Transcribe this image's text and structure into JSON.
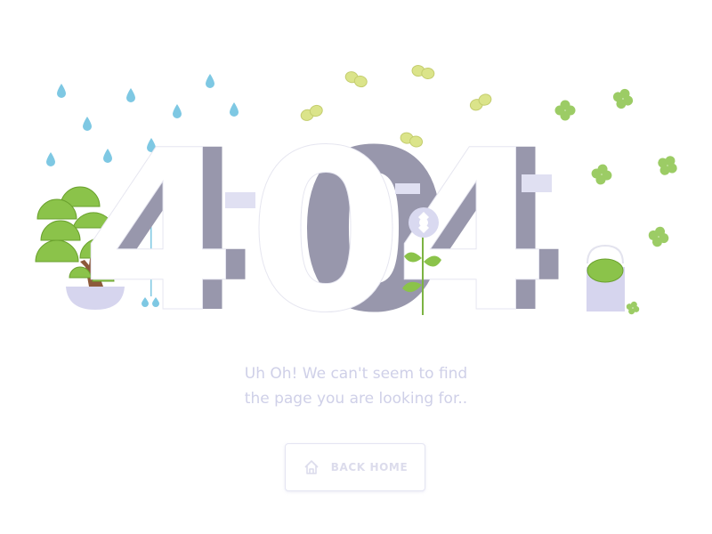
{
  "error": {
    "digit_1": "4",
    "digit_2": "0",
    "digit_3": "4"
  },
  "message": {
    "line_1": "Uh Oh!  We can't seem to find",
    "line_2": "the page you are looking for.."
  },
  "back_button": {
    "label": "BACK HOME",
    "icon": "home-icon"
  },
  "colors": {
    "shadow_digits": "#9897ac",
    "text": "#cfd0e8",
    "leaf": "#8bc34a",
    "raindrop": "#7ec8e3",
    "butterfly": "#dbe48a",
    "clover": "#9ccc65",
    "pot": "#d6d5ee"
  },
  "illustration": {
    "left": "bonsai tree with rain",
    "center": "flower growing through zero",
    "right": "watering bucket with clovers"
  }
}
